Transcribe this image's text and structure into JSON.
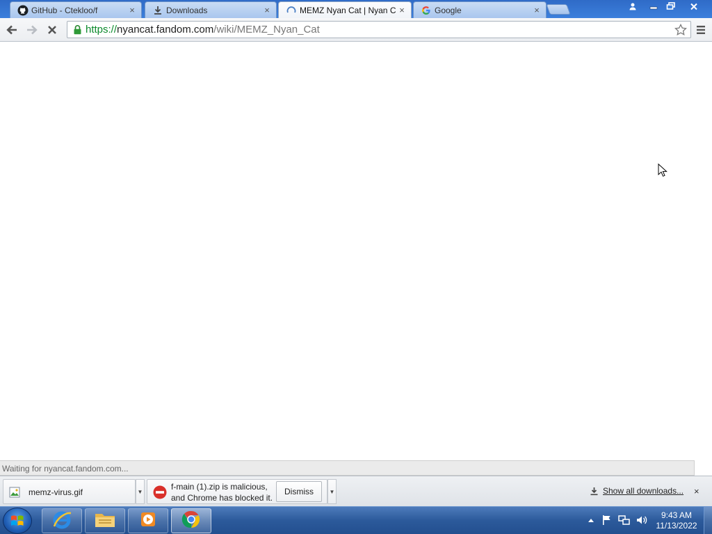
{
  "browser": {
    "tabs": [
      {
        "title": "GitHub - Ctekloo/f",
        "favicon": "github-icon",
        "active": false
      },
      {
        "title": "Downloads",
        "favicon": "download-icon",
        "active": false
      },
      {
        "title": "MEMZ Nyan Cat | Nyan C",
        "favicon": "loading-spinner-icon",
        "active": true
      },
      {
        "title": "Google",
        "favicon": "google-icon",
        "active": false
      }
    ],
    "close_glyph": "×",
    "address": {
      "scheme": "https://",
      "host": "nyancat.fandom.com",
      "path": "/wiki/MEMZ_Nyan_Cat"
    },
    "status_text": "Waiting for nyancat.fandom.com..."
  },
  "downloads": {
    "items": [
      {
        "name": "memz-virus.gif",
        "icon": "image-file-icon"
      },
      {
        "line1": "f-main (1).zip is malicious,",
        "line2": "and Chrome has blocked it.",
        "icon": "blocked-icon",
        "action": "Dismiss"
      }
    ],
    "show_all": "Show all downloads...",
    "close_glyph": "×"
  },
  "taskbar": {
    "apps": [
      "internet-explorer-icon",
      "file-explorer-icon",
      "media-player-icon",
      "chrome-icon"
    ],
    "active_app": "chrome-icon",
    "tray_icons": [
      "show-hidden-icons-arrow",
      "action-center-flag-icon",
      "network-icon",
      "volume-icon"
    ],
    "clock_time": "9:43 AM",
    "clock_date": "11/13/2022"
  },
  "colors": {
    "tab_strip": "#3c7fdc",
    "secure_scheme": "#0b8a2c",
    "blocked_red": "#d9302a",
    "taskbar": "#2c5a9b"
  }
}
